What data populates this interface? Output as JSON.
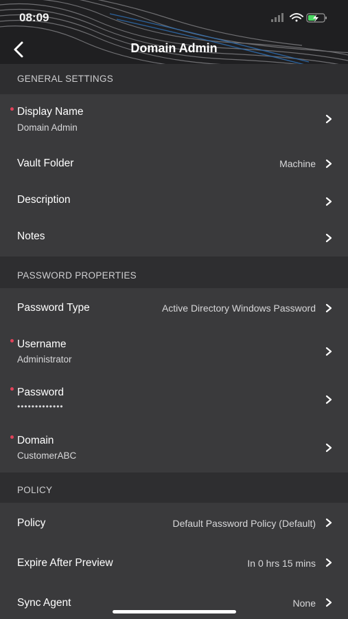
{
  "status_bar": {
    "time": "08:09"
  },
  "nav": {
    "title": "Domain Admin",
    "back_icon": "chevron-left-icon"
  },
  "general": {
    "header": "GENERAL SETTINGS",
    "display_name": {
      "label": "Display Name",
      "value": "Domain Admin",
      "required": true
    },
    "vault_folder": {
      "label": "Vault Folder",
      "value": "Machine"
    },
    "description": {
      "label": "Description"
    },
    "notes": {
      "label": "Notes"
    }
  },
  "password_props": {
    "header": "PASSWORD PROPERTIES",
    "password_type": {
      "label": "Password Type",
      "value": "Active Directory Windows Password"
    },
    "username": {
      "label": "Username",
      "value": "Administrator",
      "required": true
    },
    "password": {
      "label": "Password",
      "value": "•••••••••••••",
      "required": true
    },
    "domain": {
      "label": "Domain",
      "value": "CustomerABC",
      "required": true
    }
  },
  "policy_section": {
    "header": "POLICY",
    "policy": {
      "label": "Policy",
      "value": "Default Password Policy (Default)"
    },
    "expire": {
      "label": "Expire After Preview",
      "value": "In 0 hrs 15 mins"
    },
    "sync_agent": {
      "label": "Sync Agent",
      "value": "None"
    }
  },
  "colors": {
    "background": "#3a3a3c",
    "section_header": "#2e2e30",
    "required_dot": "#e0435a",
    "battery": "#4cd964"
  }
}
